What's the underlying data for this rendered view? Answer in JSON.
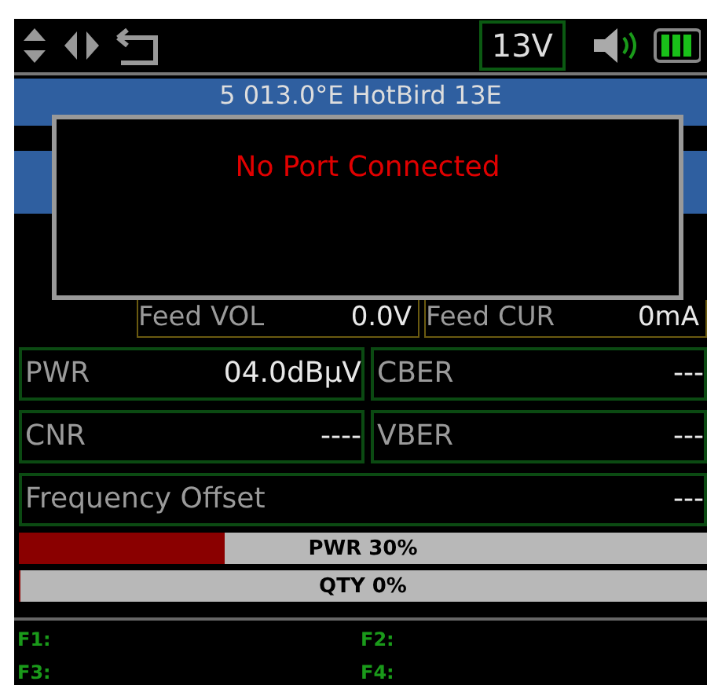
{
  "status_bar": {
    "voltage": "13V"
  },
  "satellite": {
    "title": "5  013.0°E HotBird 13E"
  },
  "dialog": {
    "message": "No Port Connected"
  },
  "feed": [
    {
      "label": "Feed VOL",
      "value": "0.0V"
    },
    {
      "label": "Feed CUR",
      "value": "0mA"
    }
  ],
  "measurement_rows": [
    {
      "left": {
        "label": "PWR",
        "value": "04.0dBµV"
      },
      "right": {
        "label": "CBER",
        "value": "---"
      }
    },
    {
      "left": {
        "label": "CNR",
        "value": "----"
      },
      "right": {
        "label": "VBER",
        "value": "---"
      }
    }
  ],
  "frequency_offset": {
    "label": "Frequency Offset",
    "value": "---"
  },
  "bars": [
    {
      "label": "PWR 30%",
      "level": 0.3
    },
    {
      "label": "QTY 0%",
      "level": 0
    }
  ],
  "function_keys": [
    "F1:",
    "F2:",
    "F3:",
    "F4:"
  ]
}
